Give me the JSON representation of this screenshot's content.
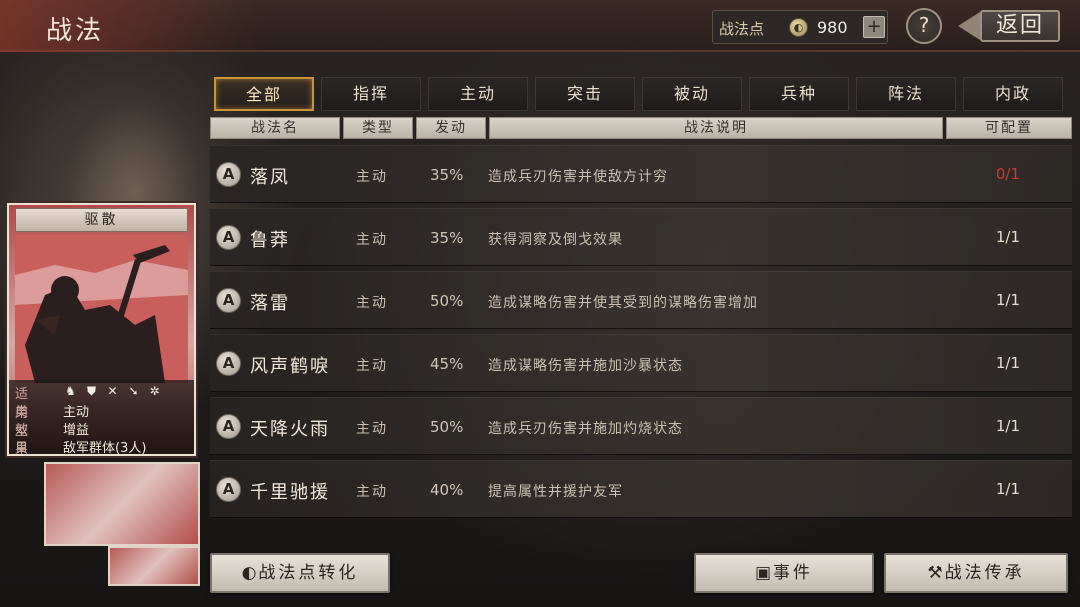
{
  "header": {
    "title": "战法",
    "points_label": "战法点",
    "points_value": "980",
    "plus_symbol": "+",
    "help_symbol": "?",
    "back_label": "返回"
  },
  "tabs": [
    {
      "label": "全部",
      "active": true
    },
    {
      "label": "指挥",
      "active": false
    },
    {
      "label": "主动",
      "active": false
    },
    {
      "label": "突击",
      "active": false
    },
    {
      "label": "被动",
      "active": false
    },
    {
      "label": "兵种",
      "active": false
    },
    {
      "label": "阵法",
      "active": false
    },
    {
      "label": "内政",
      "active": false
    }
  ],
  "columns": {
    "name": "战法名",
    "type": "类型",
    "rate": "发动",
    "desc": "战法说明",
    "slots": "可配置"
  },
  "tactics": [
    {
      "grade": "A",
      "name": "落凤",
      "type": "主动",
      "rate": "35%",
      "desc": "造成兵刃伤害并使敌方计穷",
      "slots": "0/1",
      "slots_highlight": true
    },
    {
      "grade": "A",
      "name": "鲁莽",
      "type": "主动",
      "rate": "35%",
      "desc": "获得洞察及倒戈效果",
      "slots": "1/1",
      "slots_highlight": false
    },
    {
      "grade": "A",
      "name": "落雷",
      "type": "主动",
      "rate": "50%",
      "desc": "造成谋略伤害并使其受到的谋略伤害增加",
      "slots": "1/1",
      "slots_highlight": false
    },
    {
      "grade": "A",
      "name": "风声鹤唳",
      "type": "主动",
      "rate": "45%",
      "desc": "造成谋略伤害并施加沙暴状态",
      "slots": "1/1",
      "slots_highlight": false
    },
    {
      "grade": "A",
      "name": "天降火雨",
      "type": "主动",
      "rate": "50%",
      "desc": "造成兵刃伤害并施加灼烧状态",
      "slots": "1/1",
      "slots_highlight": false
    },
    {
      "grade": "A",
      "name": "千里驰援",
      "type": "主动",
      "rate": "40%",
      "desc": "提高属性并援护友军",
      "slots": "1/1",
      "slots_highlight": false
    }
  ],
  "card": {
    "title": "驱散",
    "applies_label": "适用",
    "applies_icons": [
      "cavalry-icon",
      "shield-icon",
      "bow-icon",
      "spear-icon",
      "wheel-icon"
    ],
    "type_label": "类型",
    "type_value": "主动",
    "effect_label": "效果",
    "effect_value": "增益",
    "target_label": "目标",
    "target_value": "敌军群体(3人)"
  },
  "buttons": {
    "convert": "战法点转化",
    "event": "事件",
    "inherit": "战法传承"
  },
  "colors": {
    "accent_gold": "#c9923b",
    "alert_red": "#c83a2c",
    "card_red": "#b24a4a"
  }
}
